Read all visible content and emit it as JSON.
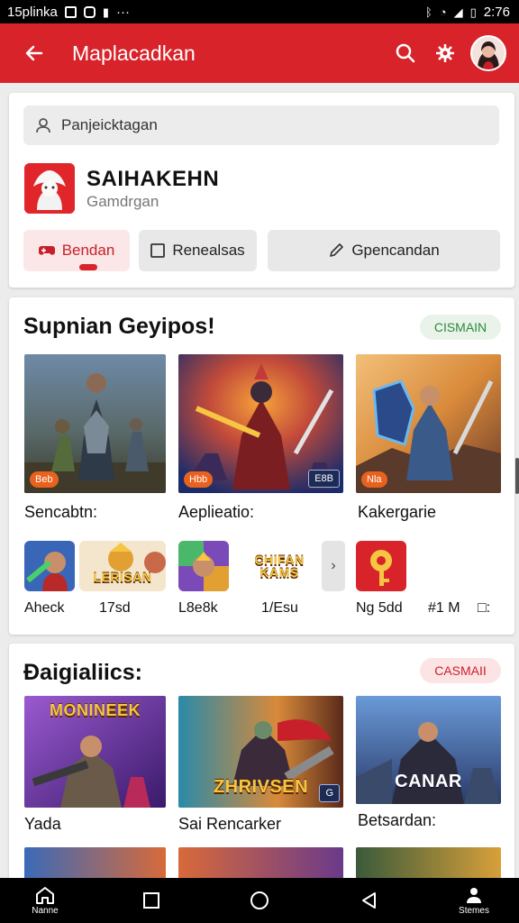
{
  "status_bar": {
    "left_text": "15plinka",
    "right_text": "2:76",
    "more": "···"
  },
  "app_bar": {
    "title": "Maplacadkan"
  },
  "header_card": {
    "search_text": "Panjeicktagan",
    "app_name": "SAIHAKEHN",
    "app_subtitle": "Gamdrgan",
    "chips": [
      {
        "label": "Bendan"
      },
      {
        "label": "Renealsas"
      },
      {
        "label": "Gpencandan"
      }
    ]
  },
  "section1": {
    "title": "Supnian Geyipos!",
    "badge": "CISMAIN",
    "cards": [
      {
        "label": "Sencabtn:",
        "tag": "Beb"
      },
      {
        "label": "Aeplieatio:",
        "tag": "Hbb",
        "tag2": "E8B"
      },
      {
        "label": "Kakergarie",
        "tag": "Nla"
      }
    ],
    "mini_apps": [
      {
        "label": "Aheck",
        "title": ""
      },
      {
        "label": "17sd",
        "title": "LERISAN"
      },
      {
        "label": "L8e8k",
        "title": ""
      },
      {
        "label": "1/Esu",
        "title": "CHIFAN KAMS"
      },
      {
        "label": "Ng 5dd",
        "title": ""
      }
    ],
    "extra_labels": [
      "#1 M",
      "□:"
    ]
  },
  "section2": {
    "title": "Ðaigialiics:",
    "badge": "CASMAII",
    "cards": [
      {
        "label": "Yada",
        "title": "MONINEEK"
      },
      {
        "label": "Sai Rencarker",
        "title": "ZHRIVSEN",
        "tag": "G"
      },
      {
        "label": "Betsardan:",
        "title": "CANAR"
      }
    ]
  },
  "nav_bar": {
    "left_label": "Nanne",
    "right_label": "Stemes"
  },
  "colors": {
    "accent": "#d8232a",
    "accent_soft": "#fbe7e7",
    "badge_green": "#2a8a3a"
  }
}
